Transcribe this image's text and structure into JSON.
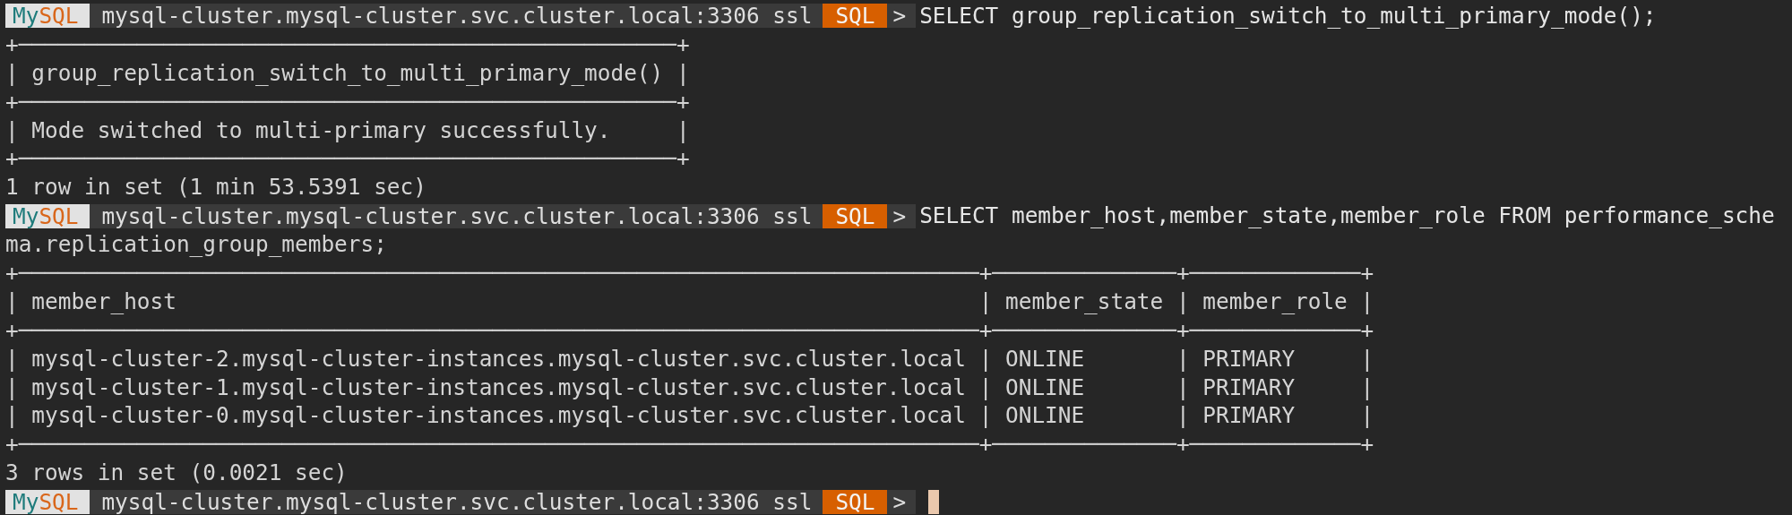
{
  "lines": [
    {
      "kind": "prompt",
      "logo": [
        "My",
        "SQL"
      ],
      "host": "mysql-cluster.mysql-cluster.svc.cluster.local:3306",
      "ssl": "ssl",
      "mode": "SQL",
      "arrow": ">",
      "command": "SELECT group_replication_switch_to_multi_primary_mode();",
      "cursor": false
    },
    {
      "kind": "output",
      "text": "+──────────────────────────────────────────────────+"
    },
    {
      "kind": "output",
      "text": "| group_replication_switch_to_multi_primary_mode() |"
    },
    {
      "kind": "output",
      "text": "+──────────────────────────────────────────────────+"
    },
    {
      "kind": "output",
      "text": "| Mode switched to multi-primary successfully.     |"
    },
    {
      "kind": "output",
      "text": "+──────────────────────────────────────────────────+"
    },
    {
      "kind": "output",
      "text": "1 row in set (1 min 53.5391 sec)"
    },
    {
      "kind": "prompt",
      "logo": [
        "My",
        "SQL"
      ],
      "host": "mysql-cluster.mysql-cluster.svc.cluster.local:3306",
      "ssl": "ssl",
      "mode": "SQL",
      "arrow": ">",
      "command": "SELECT member_host,member_state,member_role FROM performance_sche",
      "cursor": false
    },
    {
      "kind": "output",
      "text": "ma.replication_group_members;"
    },
    {
      "kind": "output",
      "text": "+─────────────────────────────────────────────────────────────────────────+──────────────+─────────────+"
    },
    {
      "kind": "output",
      "text": "| member_host                                                             | member_state | member_role |"
    },
    {
      "kind": "output",
      "text": "+─────────────────────────────────────────────────────────────────────────+──────────────+─────────────+"
    },
    {
      "kind": "output",
      "text": "| mysql-cluster-2.mysql-cluster-instances.mysql-cluster.svc.cluster.local | ONLINE       | PRIMARY     |"
    },
    {
      "kind": "output",
      "text": "| mysql-cluster-1.mysql-cluster-instances.mysql-cluster.svc.cluster.local | ONLINE       | PRIMARY     |"
    },
    {
      "kind": "output",
      "text": "| mysql-cluster-0.mysql-cluster-instances.mysql-cluster.svc.cluster.local | ONLINE       | PRIMARY     |"
    },
    {
      "kind": "output",
      "text": "+─────────────────────────────────────────────────────────────────────────+──────────────+─────────────+"
    },
    {
      "kind": "output",
      "text": "3 rows in set (0.0021 sec)"
    },
    {
      "kind": "prompt",
      "logo": [
        "My",
        "SQL"
      ],
      "host": "mysql-cluster.mysql-cluster.svc.cluster.local:3306",
      "ssl": "ssl",
      "mode": "SQL",
      "arrow": ">",
      "cursor": true
    }
  ]
}
